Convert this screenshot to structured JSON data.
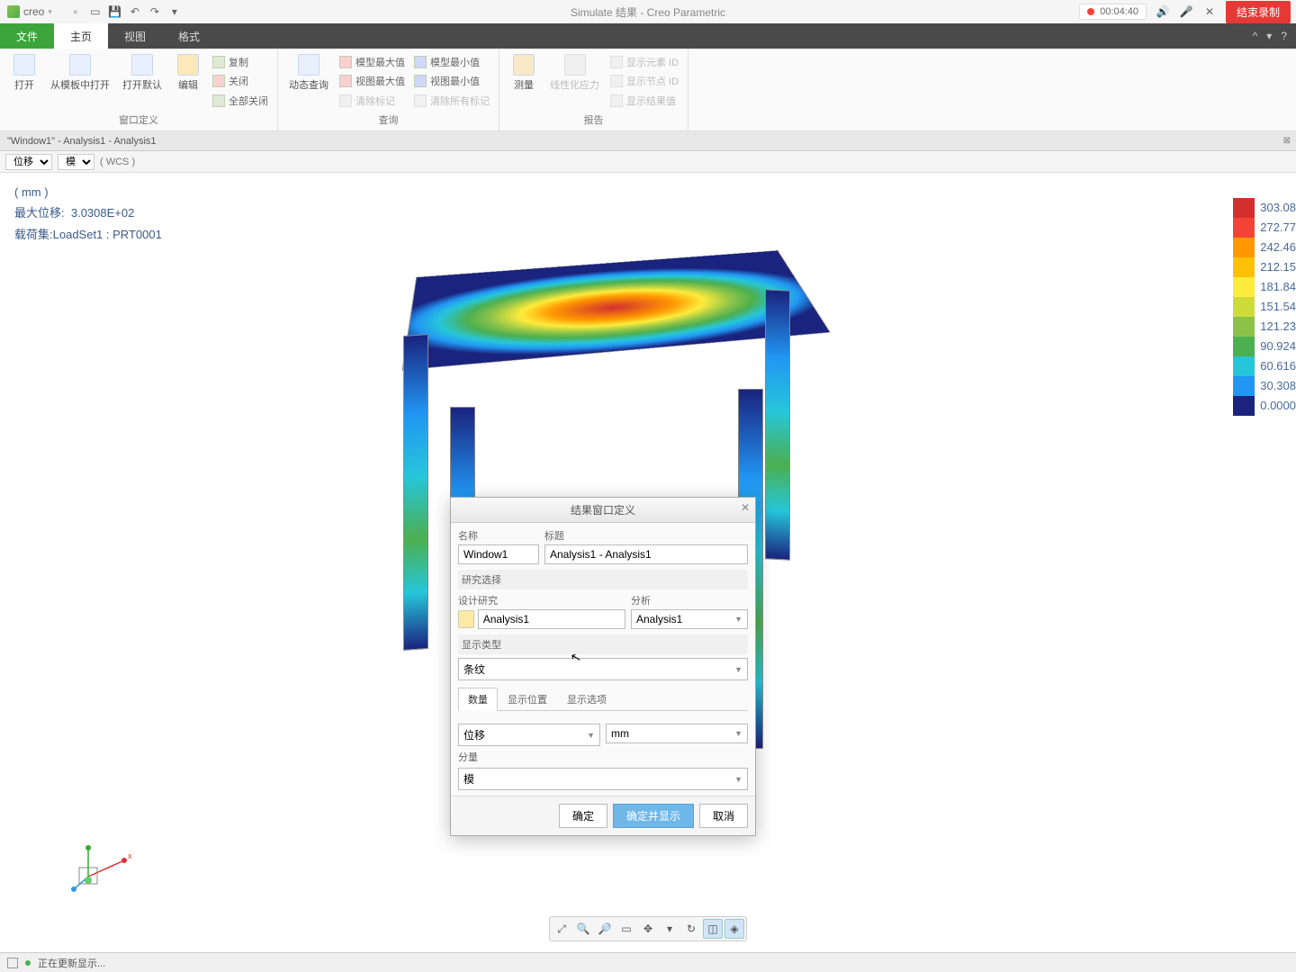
{
  "app": {
    "brand": "creo",
    "window_title": "Simulate 结果 - Creo Parametric",
    "rec_time": "00:04:40",
    "end_rec": "结束录制"
  },
  "tabs": {
    "file": "文件",
    "home": "主页",
    "view": "视图",
    "format": "格式"
  },
  "ribbon": {
    "g1": {
      "open": "打开",
      "open_tpl": "从模板中打开",
      "open_def": "打开默认",
      "edit": "编辑",
      "label": "窗口定义"
    },
    "g1b": {
      "copy": "复制",
      "close": "关闭",
      "close_all": "全部关闭"
    },
    "g2": {
      "dyn": "动态查询",
      "mmax": "模型最大值",
      "mmin": "模型最小值",
      "vmax": "视图最大值",
      "vmin": "视图最小值",
      "clr": "清除标记",
      "clrall": "清除所有标记",
      "label": "查询"
    },
    "g3": {
      "measure": "测量",
      "linear": "线性化应力",
      "elem": "显示元素 ID",
      "node": "显示节点 ID",
      "res": "显示结果值",
      "label": "报告"
    }
  },
  "doc_tab": "\"Window1\" - Analysis1 - Analysis1",
  "selectors": {
    "quantity": "位移",
    "component": "模",
    "wcs": "( WCS )"
  },
  "overlay": {
    "unit": "( mm )",
    "line1_lbl": "最大位移:",
    "line1_val": "3.0308E+02",
    "line2_lbl": "载荷集:",
    "line2_val": "LoadSet1 : PRT0001"
  },
  "legend": {
    "values": [
      "303.08",
      "272.77",
      "242.46",
      "212.15",
      "181.84",
      "151.54",
      "121.23",
      "90.924",
      "60.616",
      "30.308",
      "0.0000"
    ],
    "colors": [
      "#d32f2f",
      "#f44336",
      "#ff9800",
      "#ffc107",
      "#ffeb3b",
      "#cddc39",
      "#8bc34a",
      "#4caf50",
      "#26c6da",
      "#2196f3",
      "#1a237e"
    ]
  },
  "dialog": {
    "title": "结果窗口定义",
    "name_lbl": "名称",
    "name_val": "Window1",
    "title_lbl": "标题",
    "title_val": "Analysis1 - Analysis1",
    "sec_study": "研究选择",
    "design_lbl": "设计研究",
    "design_val": "Analysis1",
    "analysis_lbl": "分析",
    "analysis_val": "Analysis1",
    "sec_disp": "显示类型",
    "disp_val": "条纹",
    "tabs": {
      "qty": "数量",
      "loc": "显示位置",
      "opt": "显示选项"
    },
    "qty_val": "位移",
    "unit_val": "mm",
    "comp_lbl": "分量",
    "comp_val": "模",
    "ok": "确定",
    "ok_show": "确定并显示",
    "cancel": "取消"
  },
  "status": "正在更新显示..."
}
